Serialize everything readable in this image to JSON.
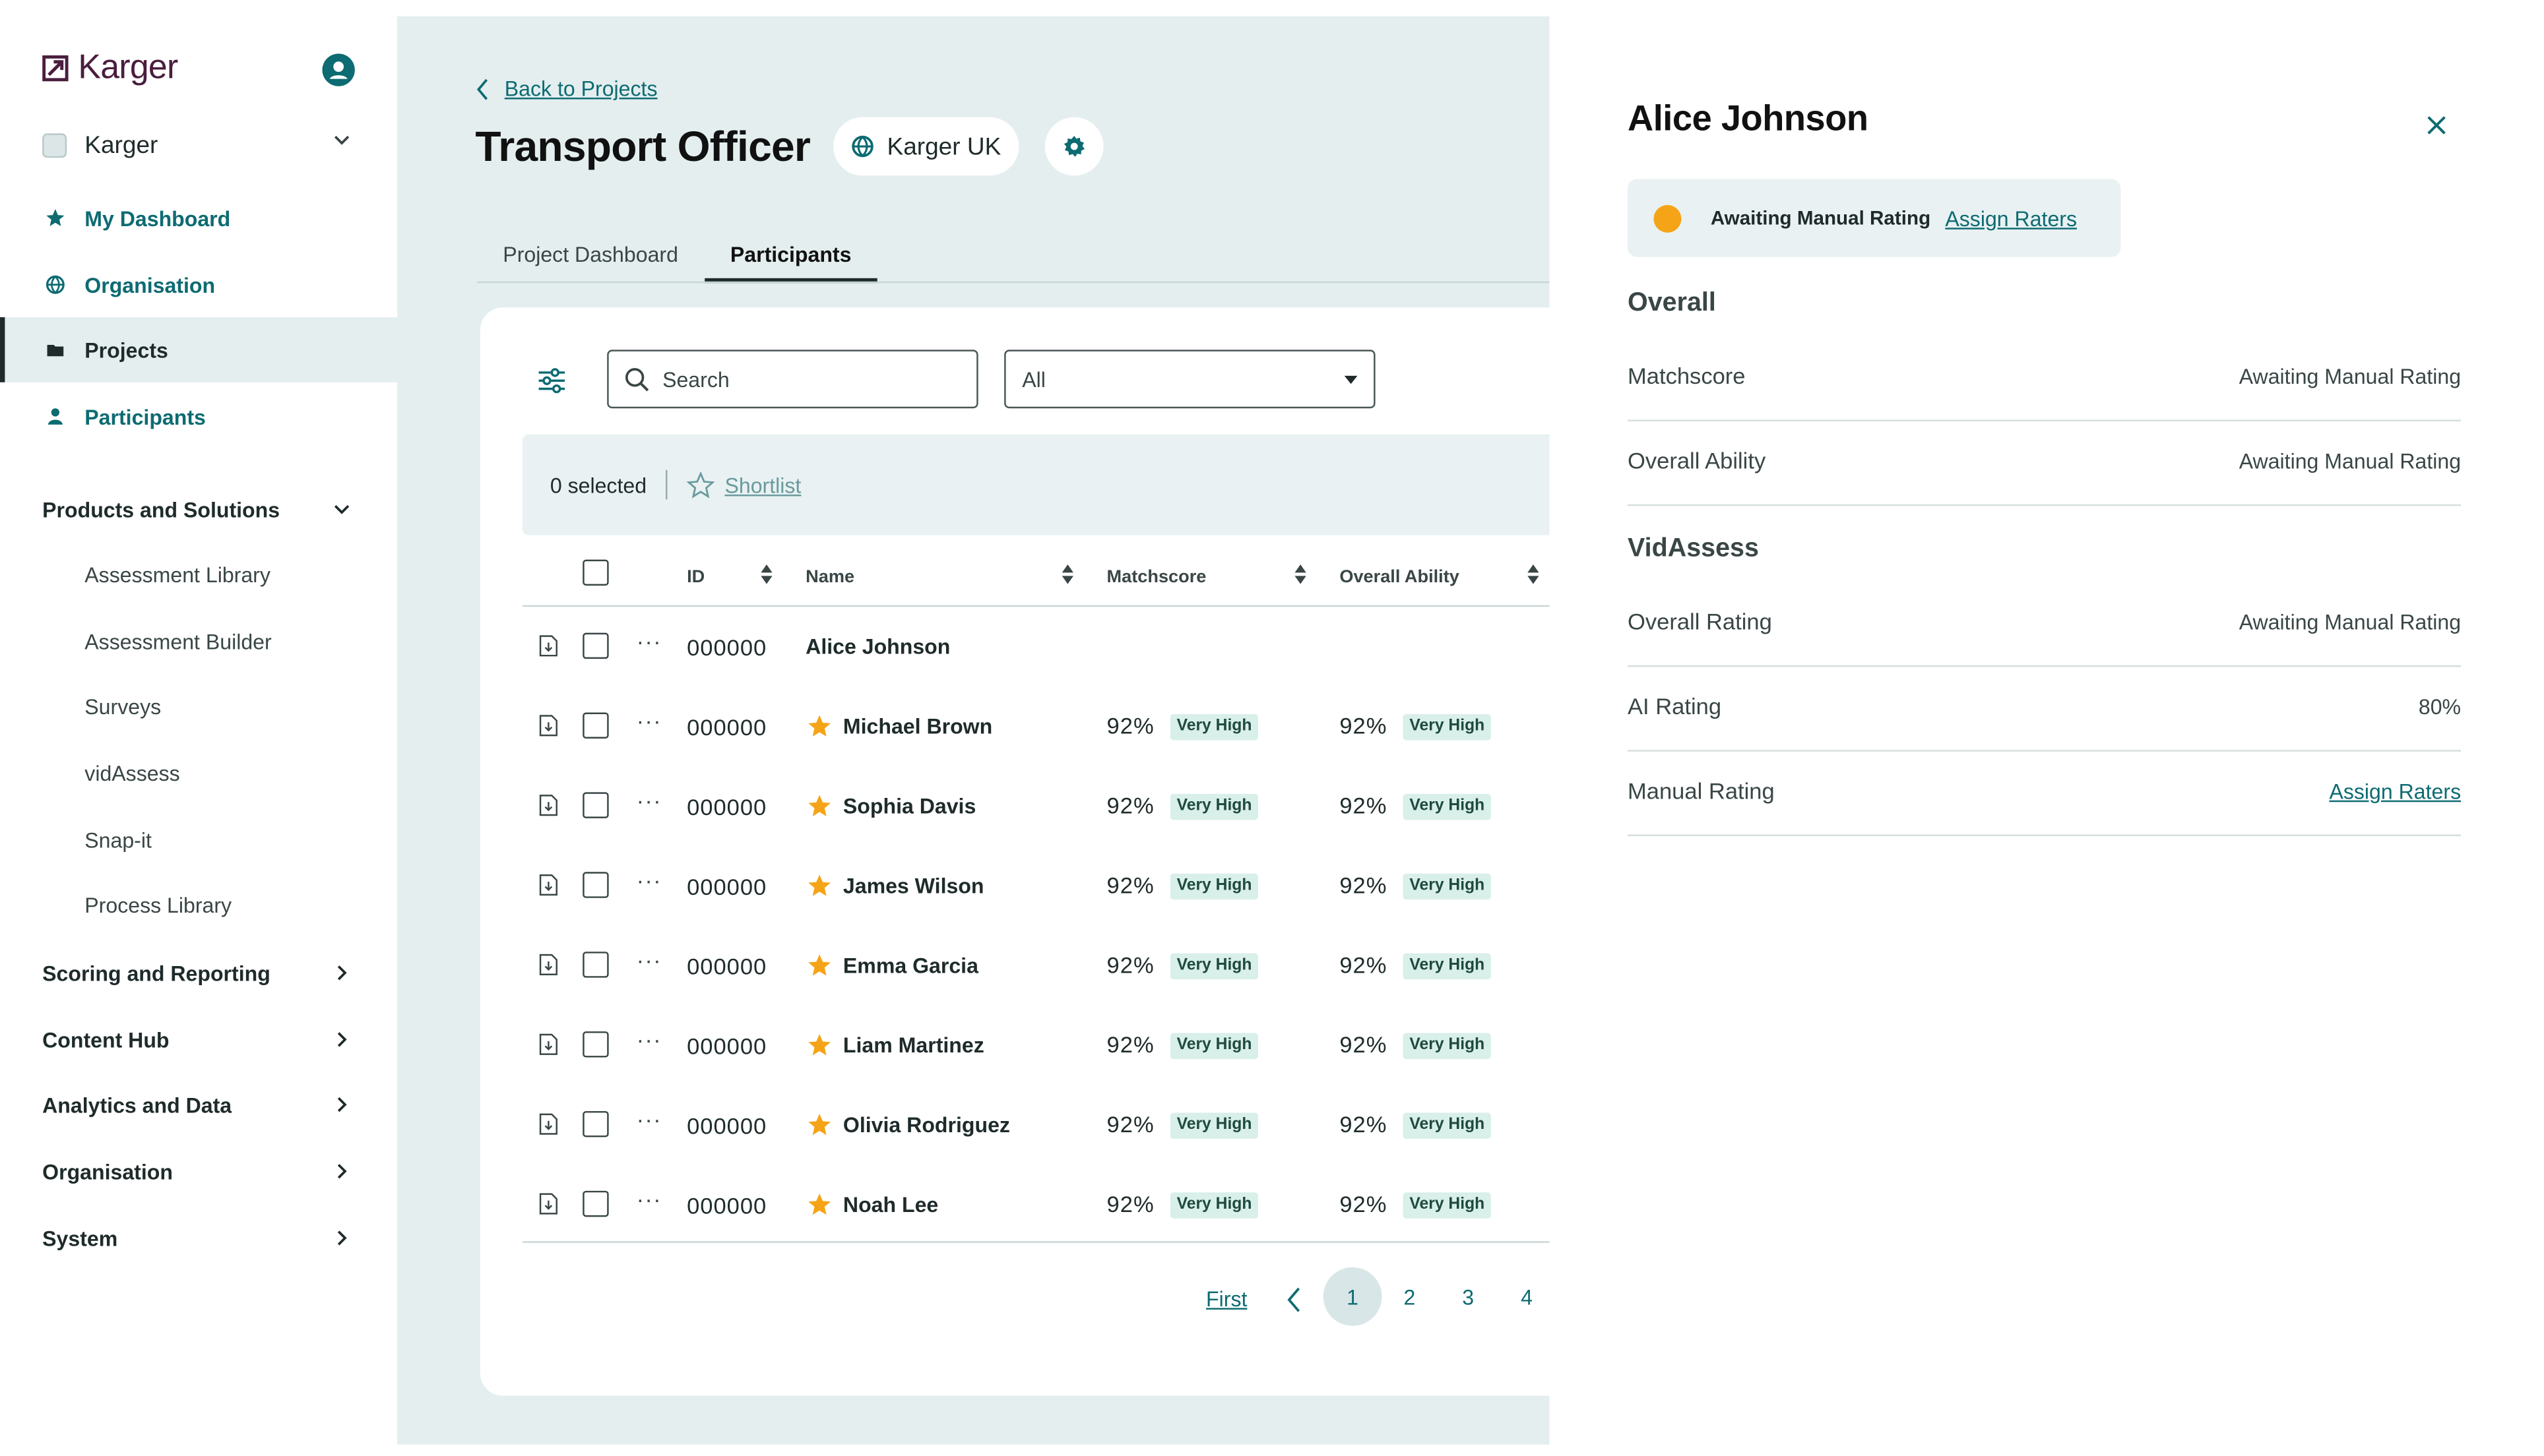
{
  "brand": {
    "name": "Karger"
  },
  "sidebar": {
    "org_switch": "Karger",
    "nav": [
      {
        "label": "My Dashboard",
        "icon": "star-icon"
      },
      {
        "label": "Organisation",
        "icon": "globe-icon"
      },
      {
        "label": "Projects",
        "icon": "folder-icon"
      },
      {
        "label": "Participants",
        "icon": "person-icon"
      }
    ],
    "products": {
      "label": "Products and Solutions",
      "items": [
        "Assessment Library",
        "Assessment Builder",
        "Surveys",
        "vidAssess",
        "Snap-it",
        "Process Library"
      ]
    },
    "sections": [
      "Scoring and Reporting",
      "Content Hub",
      "Analytics and Data",
      "Organisation",
      "System"
    ]
  },
  "project": {
    "back_label": "Back to Projects",
    "title": "Transport Officer",
    "org_pill": "Karger UK",
    "tabs": [
      "Project Dashboard",
      "Participants"
    ],
    "active_tab": "Participants"
  },
  "table": {
    "search_placeholder": "Search",
    "filter_value": "All",
    "selected_label": "0 selected",
    "shortlist_label": "Shortlist",
    "headers": {
      "id": "ID",
      "name": "Name",
      "matchscore": "Matchscore",
      "ability": "Overall Ability"
    },
    "rows": [
      {
        "id": "000000",
        "name": "Alice Johnson",
        "starred": false,
        "matchscore": "",
        "match_badge": "",
        "ability": "",
        "ability_badge": ""
      },
      {
        "id": "000000",
        "name": "Michael Brown",
        "starred": true,
        "matchscore": "92%",
        "match_badge": "Very High",
        "ability": "92%",
        "ability_badge": "Very High"
      },
      {
        "id": "000000",
        "name": "Sophia Davis",
        "starred": true,
        "matchscore": "92%",
        "match_badge": "Very High",
        "ability": "92%",
        "ability_badge": "Very High"
      },
      {
        "id": "000000",
        "name": "James Wilson",
        "starred": true,
        "matchscore": "92%",
        "match_badge": "Very High",
        "ability": "92%",
        "ability_badge": "Very High"
      },
      {
        "id": "000000",
        "name": "Emma Garcia",
        "starred": true,
        "matchscore": "92%",
        "match_badge": "Very High",
        "ability": "92%",
        "ability_badge": "Very High"
      },
      {
        "id": "000000",
        "name": "Liam Martinez",
        "starred": true,
        "matchscore": "92%",
        "match_badge": "Very High",
        "ability": "92%",
        "ability_badge": "Very High"
      },
      {
        "id": "000000",
        "name": "Olivia Rodriguez",
        "starred": true,
        "matchscore": "92%",
        "match_badge": "Very High",
        "ability": "92%",
        "ability_badge": "Very High"
      },
      {
        "id": "000000",
        "name": "Noah Lee",
        "starred": true,
        "matchscore": "92%",
        "match_badge": "Very High",
        "ability": "92%",
        "ability_badge": "Very High"
      }
    ],
    "pagination": {
      "first": "First",
      "pages": [
        "1",
        "2",
        "3",
        "4"
      ],
      "current": "1"
    }
  },
  "panel": {
    "name": "Alice Johnson",
    "status": {
      "text": "Awaiting Manual Rating",
      "link": "Assign Raters",
      "color": "#f5a417"
    },
    "overall": {
      "heading": "Overall",
      "rows": [
        {
          "label": "Matchscore",
          "value": "Awaiting Manual Rating"
        },
        {
          "label": "Overall Ability",
          "value": "Awaiting Manual Rating"
        }
      ]
    },
    "vidassess": {
      "heading": "VidAssess",
      "rows": [
        {
          "label": "Overall Rating",
          "value": "Awaiting Manual Rating"
        },
        {
          "label": "AI Rating",
          "value": "80%"
        },
        {
          "label": "Manual Rating",
          "value": "Assign Raters"
        }
      ]
    }
  },
  "colors": {
    "accent": "#0d6b72",
    "main_bg": "#e4eeef",
    "brand": "#4a1d3d",
    "star": "#f5a417",
    "badge_bg": "#d9efe9"
  }
}
